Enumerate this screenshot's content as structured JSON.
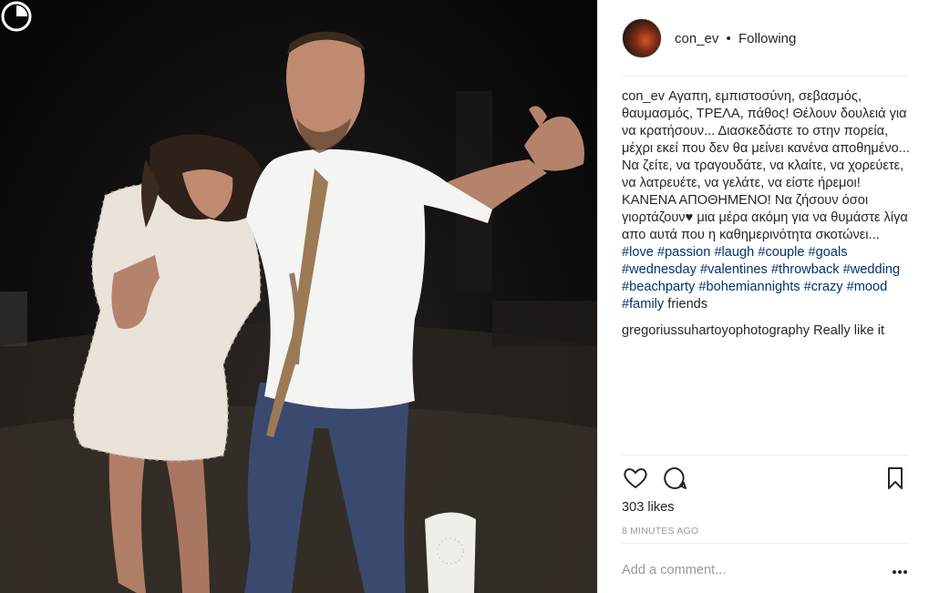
{
  "post": {
    "username": "con_ev",
    "separator": "•",
    "follow_status": "Following"
  },
  "caption": {
    "author": "con_ev",
    "text": "Αγαπη, εμπιστοσύνη, σεβασμός, θαυμασμός, ΤΡΕΛΑ, πάθος! Θέλουν δουλειά για να κρατήσουν... Διασκεδάστε το στην πορεία, μέχρι εκεί που δεν θα μείνει κανένα αποθημένο... Να ζείτε, να τραγουδάτε, να κλαίτε, να χορεύετε, να λατρευέτε, να γελάτε, να είστε ήρεμοι! ΚΑΝΕΝΑ ΑΠΟΘΗΜΕΝΟ! Να ζήσουν όσοι γιορτάζουν",
    "heart": "♥",
    "text2": " μια μέρα ακόμη για να θυμάστε λίγα απο αυτά που η καθημερινότητα σκοτώνει... ",
    "hashtags": [
      "#love",
      "#passion",
      "#laugh",
      "#couple",
      "#goals",
      "#wednesday",
      "#valentines",
      "#throwback",
      "#wedding",
      "#beachparty",
      "#bohemiannights",
      "#crazy",
      "#mood",
      "#family"
    ],
    "tail": "friends"
  },
  "comments": [
    {
      "author": "gregoriussuhartoyophotography",
      "text": "Really like it"
    }
  ],
  "actions": {
    "like_icon": "heart-outline-icon",
    "comment_icon": "speech-bubble-icon",
    "save_icon": "bookmark-icon"
  },
  "likes": "303 likes",
  "time_ago": "8 MINUTES AGO",
  "add_comment_placeholder": "Add a comment...",
  "more_icon": "more-options-icon"
}
